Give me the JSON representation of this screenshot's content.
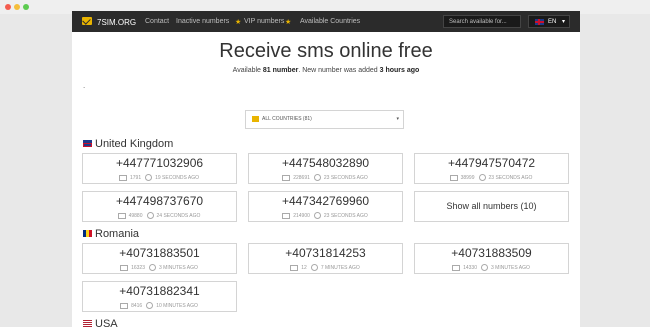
{
  "colors": {
    "nav_bg": "#2b2b2b",
    "accent": "#e9b400"
  },
  "nav": {
    "brand": "7SIM.ORG",
    "links": [
      "Contact",
      "Inactive numbers",
      "VIP numbers",
      "Available Countries"
    ],
    "search_placeholder": "Search available for...",
    "language": "EN"
  },
  "header": {
    "title": "Receive sms online free",
    "sub_prefix": "Available ",
    "count": "81 number",
    "sub_mid": ". New number was added ",
    "added": "3 hours ago",
    "dot": "."
  },
  "filter": {
    "label": "ALL COUNTRIES (81)"
  },
  "countries": [
    {
      "name": "United Kingdom",
      "numbers": [
        {
          "number": "+447771032906",
          "sms": "1791",
          "time": "19 SECONDS AGO"
        },
        {
          "number": "+447548032890",
          "sms": "228691",
          "time": "23 SECONDS AGO"
        },
        {
          "number": "+447947570472",
          "sms": "38999",
          "time": "23 SECONDS AGO"
        },
        {
          "number": "+447498737670",
          "sms": "49880",
          "time": "24 SECONDS AGO"
        },
        {
          "number": "+447342769960",
          "sms": "214900",
          "time": "23 SECONDS AGO"
        }
      ],
      "show_all": "Show all numbers (10)"
    },
    {
      "name": "Romania",
      "numbers": [
        {
          "number": "+40731883501",
          "sms": "16323",
          "time": "3 MINUTES AGO"
        },
        {
          "number": "+40731814253",
          "sms": "12",
          "time": "7 MINUTES AGO"
        },
        {
          "number": "+40731883509",
          "sms": "14330",
          "time": "3 MINUTES AGO"
        },
        {
          "number": "+40731882341",
          "sms": "8416",
          "time": "10 MINUTES AGO"
        }
      ]
    },
    {
      "name": "USA"
    }
  ]
}
